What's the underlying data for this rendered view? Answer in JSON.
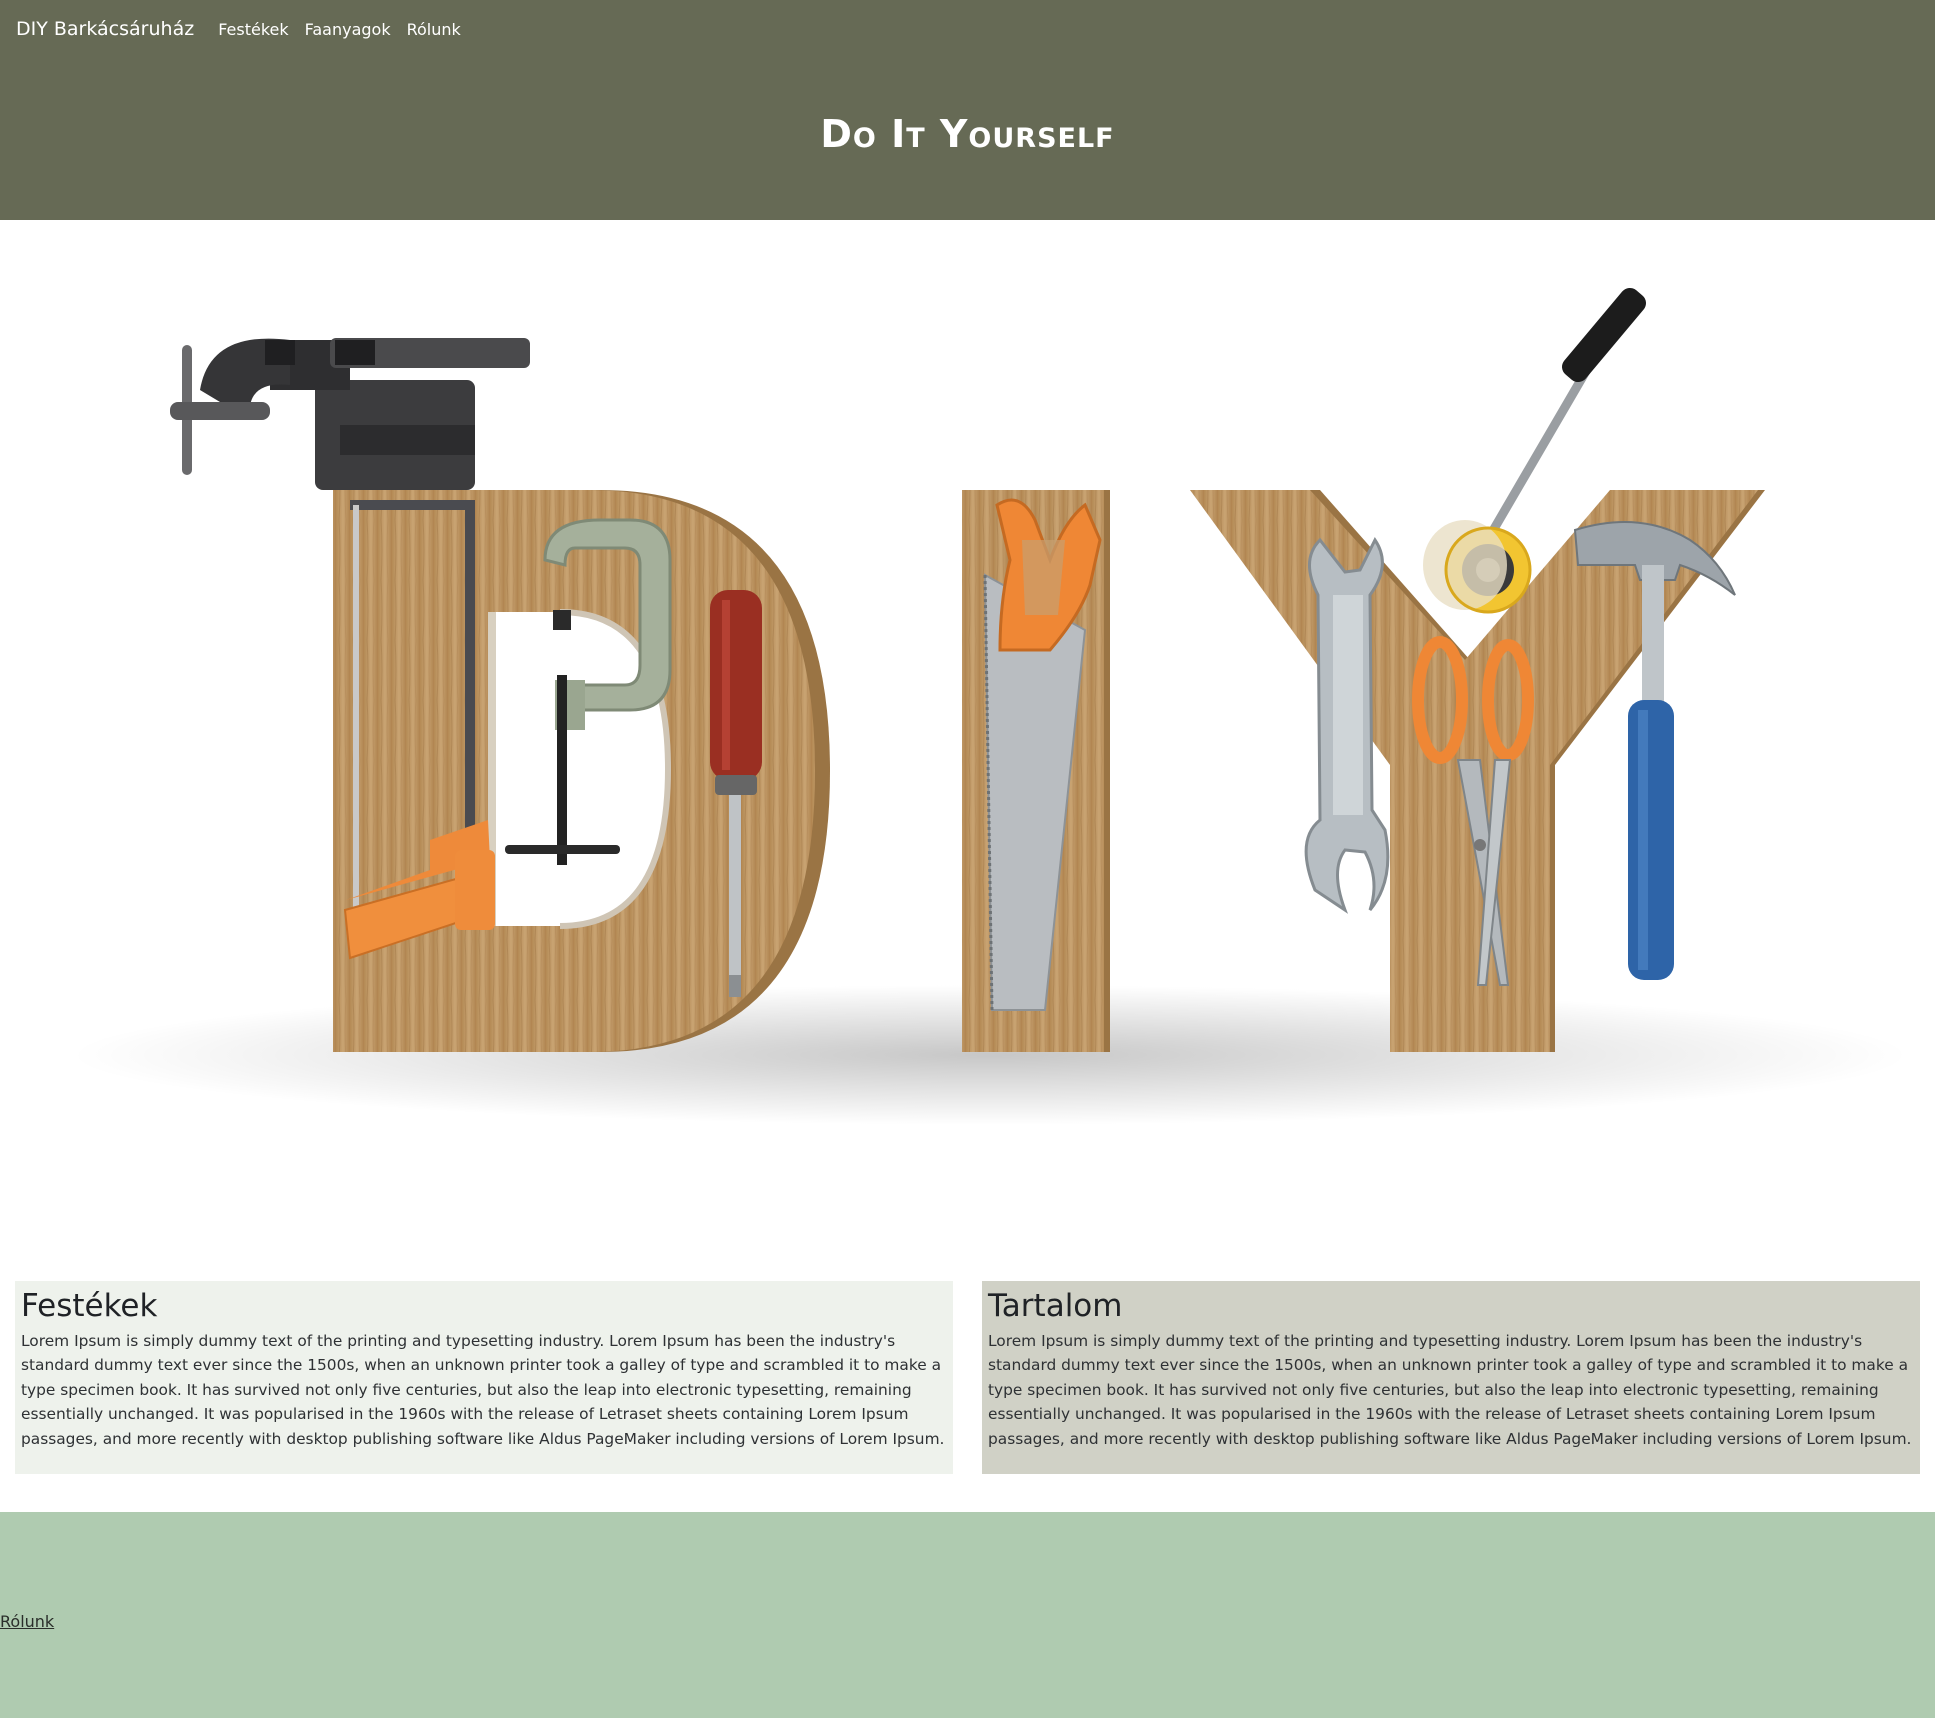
{
  "navbar": {
    "brand": "DIY Barkácsáruház",
    "links": [
      "Festékek",
      "Faanyagok",
      "Rólunk"
    ]
  },
  "header": {
    "title": "Do It Yourself"
  },
  "hero": {
    "image_text": "DIY",
    "icons": [
      "bench-vise-icon",
      "hacksaw-icon",
      "c-clamp-icon",
      "screwdriver-icon",
      "handsaw-icon",
      "wrench-icon",
      "scissors-icon",
      "paint-roller-icon",
      "hammer-icon"
    ]
  },
  "cards": [
    {
      "title": "Festékek",
      "text": "Lorem Ipsum is simply dummy text of the printing and typesetting industry. Lorem Ipsum has been the industry's standard dummy text ever since the 1500s, when an unknown printer took a galley of type and scrambled it to make a type specimen book. It has survived not only five centuries, but also the leap into electronic typesetting, remaining essentially unchanged. It was popularised in the 1960s with the release of Letraset sheets containing Lorem Ipsum passages, and more recently with desktop publishing software like Aldus PageMaker including versions of Lorem Ipsum."
    },
    {
      "title": "Tartalom",
      "text": "Lorem Ipsum is simply dummy text of the printing and typesetting industry. Lorem Ipsum has been the industry's standard dummy text ever since the 1500s, when an unknown printer took a galley of type and scrambled it to make a type specimen book. It has survived not only five centuries, but also the leap into electronic typesetting, remaining essentially unchanged. It was popularised in the 1960s with the release of Letraset sheets containing Lorem Ipsum passages, and more recently with desktop publishing software like Aldus PageMaker including versions of Lorem Ipsum."
    }
  ],
  "footer": {
    "label": "Rólunk"
  },
  "colors": {
    "header_bg": "#666a55",
    "card_left_bg": "#eef2ec",
    "card_right_bg": "#d0d1c6",
    "footer_bg": "#afcbb0"
  }
}
